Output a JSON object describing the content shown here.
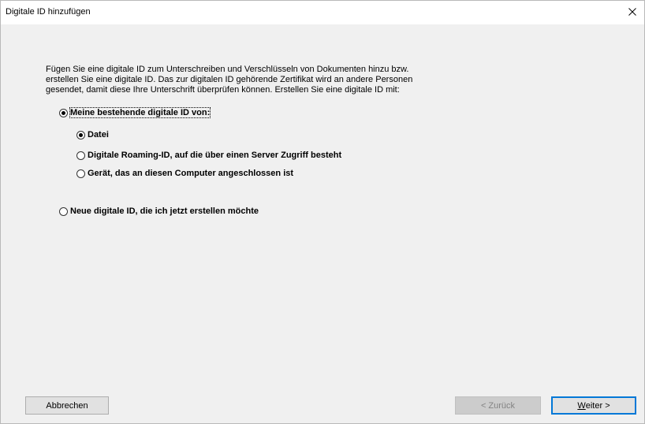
{
  "window": {
    "title": "Digitale ID hinzufügen",
    "close_glyph": "×"
  },
  "description": {
    "line1": "Fügen Sie eine digitale ID zum Unterschreiben und Verschlüsseln von Dokumenten hinzu bzw.",
    "line2": "erstellen Sie eine digitale ID. Das zur digitalen ID gehörende Zertifikat wird an andere Personen",
    "line3": "gesendet, damit diese Ihre Unterschrift überprüfen können. Erstellen Sie eine digitale ID mit:"
  },
  "options": {
    "existing": {
      "label": "Meine bestehende digitale ID von:",
      "selected": true
    },
    "file": {
      "label": "Datei",
      "selected": true
    },
    "roaming": {
      "label": "Digitale Roaming-ID, auf die über einen Server Zugriff besteht",
      "selected": false
    },
    "device": {
      "label": "Gerät, das an diesen Computer angeschlossen ist",
      "selected": false
    },
    "new": {
      "label": "Neue digitale ID, die ich jetzt erstellen möchte",
      "selected": false
    }
  },
  "buttons": {
    "cancel": "Abbrechen",
    "back": "< Zurück",
    "next_accel": "W",
    "next_rest": "eiter >"
  },
  "colors": {
    "dialog_bg": "#f0f0f0",
    "default_button_border": "#0078d7"
  }
}
